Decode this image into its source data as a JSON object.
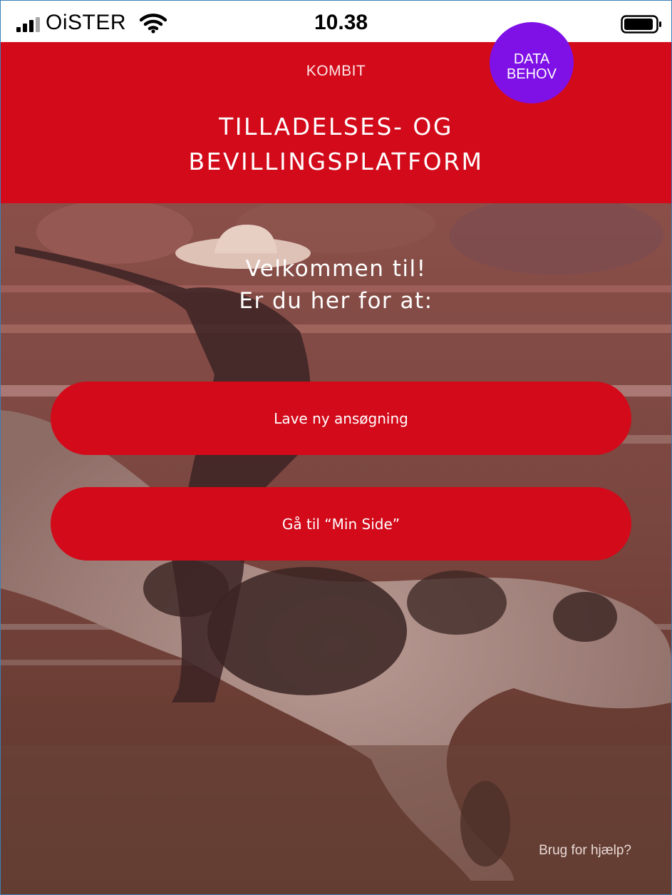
{
  "status_bar": {
    "carrier": "OiSTER",
    "time": "10.38",
    "icons": [
      "signal-icon",
      "wifi-icon",
      "battery-icon"
    ]
  },
  "header": {
    "brand": "KOMBIT",
    "title_line1": "TILLADELSES- OG",
    "title_line2": "BEVILLINGSPLATFORM",
    "note": {
      "line1": "DATA",
      "line2": "BEHOV"
    },
    "background_color": "#d20a1a",
    "note_color": "#7f11e6"
  },
  "hero": {
    "welcome_line1": "Velkommen til!",
    "welcome_line2": "Er du her for at:",
    "buttons": [
      {
        "label": "Lave ny ansøgning"
      },
      {
        "label": "Gå til “Min Side”"
      }
    ],
    "help_link": "Brug for hjælp?",
    "button_color": "#d20a1a"
  }
}
